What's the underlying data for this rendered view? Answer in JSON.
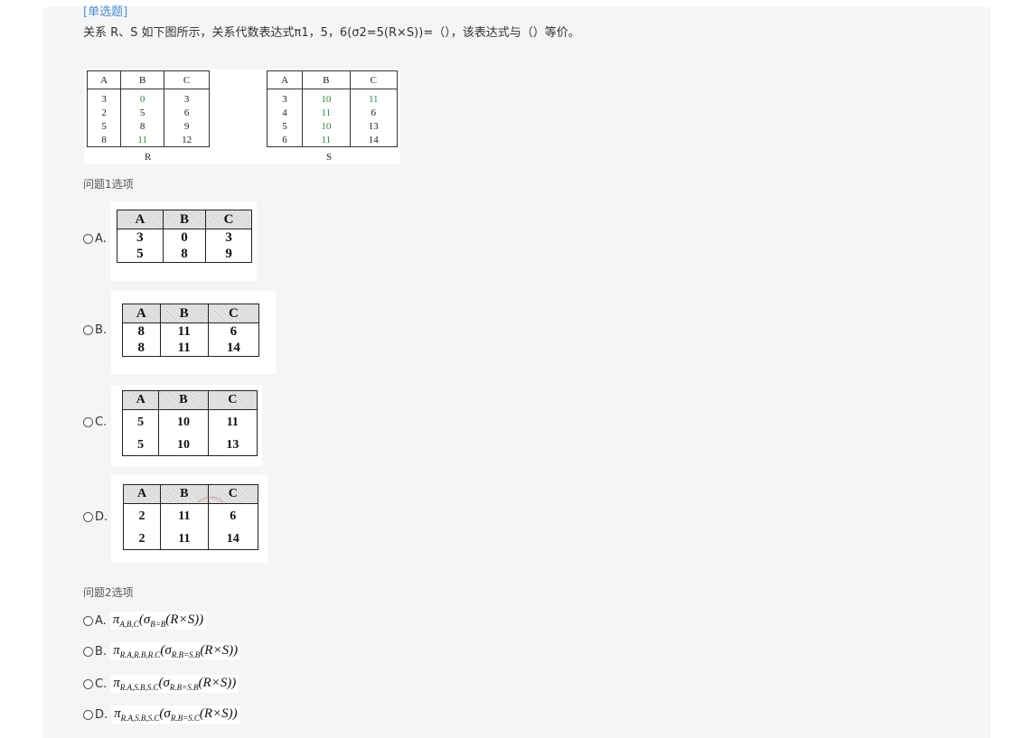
{
  "tag": "[单选题]",
  "question": "关系 R、S 如下图所示，关系代数表达式π1，5，6(σ2=5(R×S))=（），该表达式与（）等价。",
  "relation_R": {
    "caption": "R",
    "headers": [
      "A",
      "B",
      "C"
    ],
    "rows": [
      [
        "3",
        "0",
        "3"
      ],
      [
        "2",
        "5",
        "6"
      ],
      [
        "5",
        "8",
        "9"
      ],
      [
        "8",
        "11",
        "12"
      ]
    ]
  },
  "relation_S": {
    "caption": "S",
    "headers": [
      "A",
      "B",
      "C"
    ],
    "rows": [
      [
        "3",
        "10",
        "11"
      ],
      [
        "4",
        "11",
        "6"
      ],
      [
        "5",
        "10",
        "13"
      ],
      [
        "6",
        "11",
        "14"
      ]
    ]
  },
  "q1": {
    "label": "问题1选项",
    "options": [
      {
        "letter": "A.",
        "headers": [
          "A",
          "B",
          "C"
        ],
        "rows": [
          [
            "3",
            "0",
            "3"
          ],
          [
            "5",
            "8",
            "9"
          ]
        ]
      },
      {
        "letter": "B.",
        "headers": [
          "A",
          "B",
          "C"
        ],
        "rows": [
          [
            "8",
            "11",
            "6"
          ],
          [
            "8",
            "11",
            "14"
          ]
        ]
      },
      {
        "letter": "C.",
        "headers": [
          "A",
          "B",
          "C"
        ],
        "rows": [
          [
            "5",
            "10",
            "11"
          ],
          [
            "5",
            "10",
            "13"
          ]
        ]
      },
      {
        "letter": "D.",
        "headers": [
          "A",
          "B",
          "C"
        ],
        "rows": [
          [
            "2",
            "11",
            "6"
          ],
          [
            "2",
            "11",
            "14"
          ]
        ]
      }
    ]
  },
  "q2": {
    "label": "问题2选项",
    "options": [
      {
        "letter": "A.",
        "pi": "π",
        "pi_sub": "A,B,C",
        "sigma": "σ",
        "sigma_sub": "B=B",
        "body": "(R×S))"
      },
      {
        "letter": "B.",
        "pi": "π",
        "pi_sub": "R.A,R.B,R.C",
        "sigma": "σ",
        "sigma_sub": "R.B=S.B",
        "body": "(R×S))"
      },
      {
        "letter": "C.",
        "pi": "π",
        "pi_sub": "R.A,S.B,S.C",
        "sigma": "σ",
        "sigma_sub": "R.B=S.B",
        "body": "(R×S))"
      },
      {
        "letter": "D.",
        "pi": "π",
        "pi_sub": "R.A,S.B,S.C",
        "sigma": "σ",
        "sigma_sub": "R.B=S.C",
        "body": "(R×S))"
      }
    ]
  },
  "colors": {
    "tag": "#4a90d9",
    "panel": "#f5f5f5",
    "green_values": "#2e8b3e"
  }
}
